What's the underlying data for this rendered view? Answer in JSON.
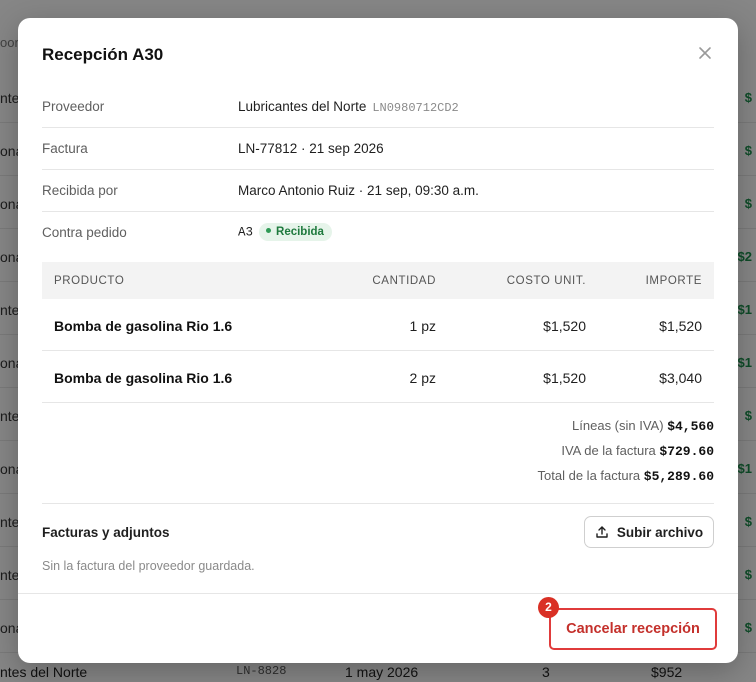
{
  "background": {
    "header_fragment": "oor",
    "rows": [
      {
        "left": "nte",
        "right": "$"
      },
      {
        "left": "ona",
        "right": "$"
      },
      {
        "left": "ona",
        "right": "$"
      },
      {
        "left": "ona",
        "right": "$2"
      },
      {
        "left": "nte",
        "right": "$1"
      },
      {
        "left": "ona",
        "right": "$1"
      },
      {
        "left": "nte",
        "right": "$"
      },
      {
        "left": "ona",
        "right": "$1"
      },
      {
        "left": "nte",
        "right": "$"
      },
      {
        "left": "nte",
        "right": "$"
      },
      {
        "left": "ona",
        "right": "$"
      }
    ],
    "bottom_row": {
      "supplier": "ntes del Norte",
      "code": "LN-8828",
      "date": "1 may 2026",
      "qty": "3",
      "amount": "$952"
    }
  },
  "modal": {
    "title": "Recepción A30",
    "close_icon": "close-icon",
    "info": {
      "supplier_label": "Proveedor",
      "supplier_name": "Lubricantes del Norte",
      "supplier_code": "LN0980712CD2",
      "invoice_label": "Factura",
      "invoice_value": "LN-77812 · 21 sep 2026",
      "received_label": "Recibida por",
      "received_value": "Marco Antonio Ruiz · 21 sep, 09:30 a.m.",
      "order_label": "Contra pedido",
      "order_value": "A3",
      "status_badge": "Recibida",
      "status_color": "#1f7a3e"
    },
    "table": {
      "headers": [
        "PRODUCTO",
        "CANTIDAD",
        "COSTO UNIT.",
        "IMPORTE"
      ],
      "rows": [
        {
          "product": "Bomba de gasolina Rio 1.6",
          "qty": "1 pz",
          "unit_cost": "$1,520",
          "amount": "$1,520"
        },
        {
          "product": "Bomba de gasolina Rio 1.6",
          "qty": "2 pz",
          "unit_cost": "$1,520",
          "amount": "$3,040"
        }
      ]
    },
    "totals": {
      "lines_label": "Líneas (sin IVA)",
      "lines_value": "$4,560",
      "iva_label": "IVA de la factura",
      "iva_value": "$729.60",
      "total_label": "Total de la factura",
      "total_value": "$5,289.60"
    },
    "attachments": {
      "title": "Facturas y adjuntos",
      "upload_label": "Subir archivo",
      "upload_icon": "upload-icon",
      "empty_text": "Sin la factura del proveedor guardada."
    },
    "footer": {
      "cancel_label": "Cancelar recepción",
      "step_number": "2",
      "danger_color": "#e03b3b"
    }
  }
}
